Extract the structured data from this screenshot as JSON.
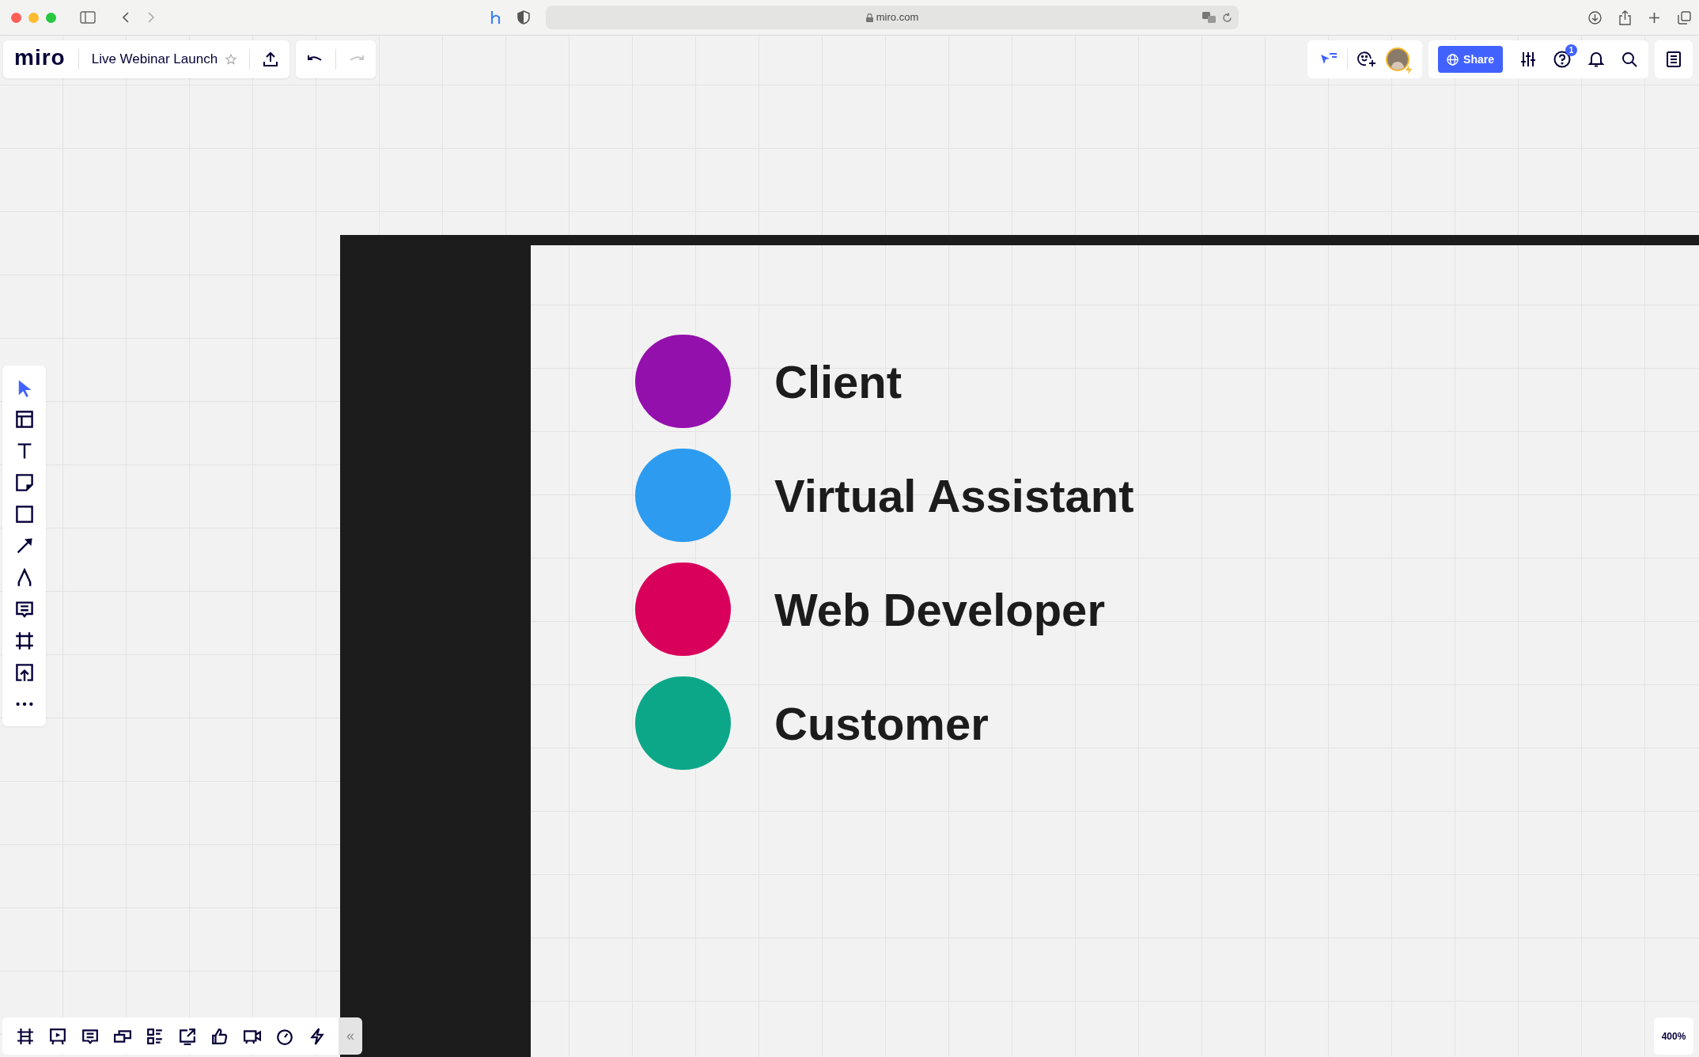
{
  "browser": {
    "url": "miro.com"
  },
  "board": {
    "logo": "miro",
    "title": "Live Webinar Launch"
  },
  "top_right": {
    "share": "Share",
    "help_badge": "1"
  },
  "left_toolbar": {
    "tools": [
      {
        "selected": true
      },
      {
        "selected": false
      },
      {
        "selected": false
      },
      {
        "selected": false
      },
      {
        "selected": false
      },
      {
        "selected": false
      },
      {
        "selected": false
      },
      {
        "selected": false
      },
      {
        "selected": false
      },
      {
        "selected": false
      },
      {
        "selected": false
      }
    ]
  },
  "bottom_toolbar": {
    "collapse": "«"
  },
  "legend": [
    {
      "label": "Client",
      "color": "#9410ad"
    },
    {
      "label": "Virtual Assistant",
      "color": "#2d9bf0"
    },
    {
      "label": "Web Developer",
      "color": "#d9005c"
    },
    {
      "label": "Customer",
      "color": "#0ca789"
    }
  ],
  "zoom": "400%"
}
